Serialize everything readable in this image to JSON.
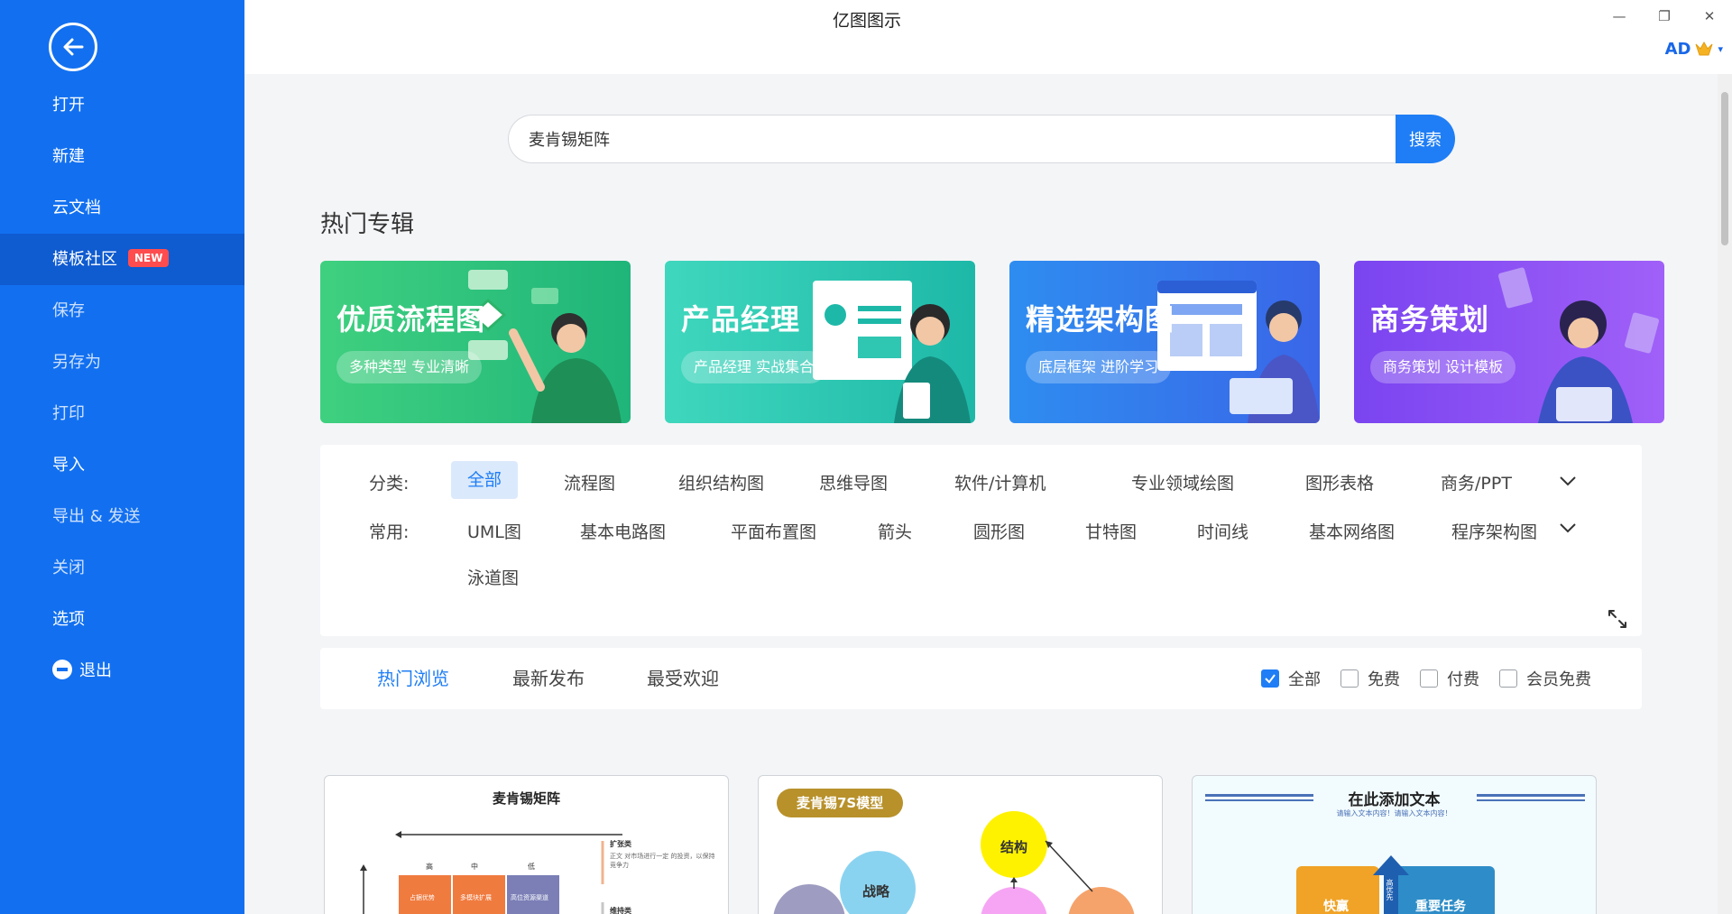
{
  "app": {
    "title": "亿图图示"
  },
  "window": {
    "minimize": "—",
    "restore": "❐",
    "close": "✕"
  },
  "user": {
    "initials": "AD",
    "caret": "▾"
  },
  "sidebar": {
    "items": [
      {
        "label": "打开"
      },
      {
        "label": "新建"
      },
      {
        "label": "云文档"
      },
      {
        "label": "模板社区",
        "badge": "NEW"
      },
      {
        "label": "保存"
      },
      {
        "label": "另存为"
      },
      {
        "label": "打印"
      },
      {
        "label": "导入"
      },
      {
        "label": "导出 & 发送"
      },
      {
        "label": "关闭"
      },
      {
        "label": "选项"
      },
      {
        "label": "退出"
      }
    ]
  },
  "search": {
    "value": "麦肯锡矩阵",
    "button": "搜索"
  },
  "hot": {
    "title": "热门专辑",
    "banners": [
      {
        "title": "优质流程图",
        "subtitle": "多种类型 专业清晰",
        "color_from": "#3fd07f",
        "color_to": "#1fb57a"
      },
      {
        "title": "产品经理",
        "subtitle": "产品经理 实战集合",
        "color_from": "#3fd7bd",
        "color_to": "#1eb8a8"
      },
      {
        "title": "精选架构图",
        "subtitle": "底层框架 进阶学习",
        "color_from": "#2e8df0",
        "color_to": "#3a66e8"
      },
      {
        "title": "商务策划",
        "subtitle": "商务策划 设计模板",
        "color_from": "#7a44f0",
        "color_to": "#a060f8"
      }
    ]
  },
  "filters": {
    "category_label": "分类:",
    "categories": [
      "全部",
      "流程图",
      "组织结构图",
      "思维导图",
      "软件/计算机",
      "专业领域绘图",
      "图形表格",
      "商务/PPT"
    ],
    "common_label": "常用:",
    "common": [
      "UML图",
      "基本电路图",
      "平面布置图",
      "箭头",
      "圆形图",
      "甘特图",
      "时间线",
      "基本网络图",
      "程序架构图",
      "泳道图"
    ]
  },
  "tabs": [
    "热门浏览",
    "最新发布",
    "最受欢迎"
  ],
  "price_filters": [
    "全部",
    "免费",
    "付费",
    "会员免费"
  ],
  "templates": [
    {
      "title": "麦肯锡矩阵",
      "row_labels": [
        "高",
        "中",
        "低"
      ],
      "cells": [
        "占据优势",
        "多模块扩展",
        "高位资源渠道"
      ],
      "side_label": "扩张类",
      "side_label_2": "维持类",
      "note": "正文 对市场进行一定 的投资，以保持竞争力"
    },
    {
      "tag": "麦肯锡7S模型",
      "nodes": [
        "结构",
        "战略"
      ]
    },
    {
      "title": "在此添加文本",
      "subtitle": "请输入文本内容！请输入文本内容！",
      "blocks": [
        "快赢",
        "重要任务"
      ],
      "arrow_label": "高优先"
    }
  ],
  "colors": {
    "sidebar": "#1270f0",
    "accent": "#1f7ef5",
    "badge": "#ff4d4f"
  }
}
